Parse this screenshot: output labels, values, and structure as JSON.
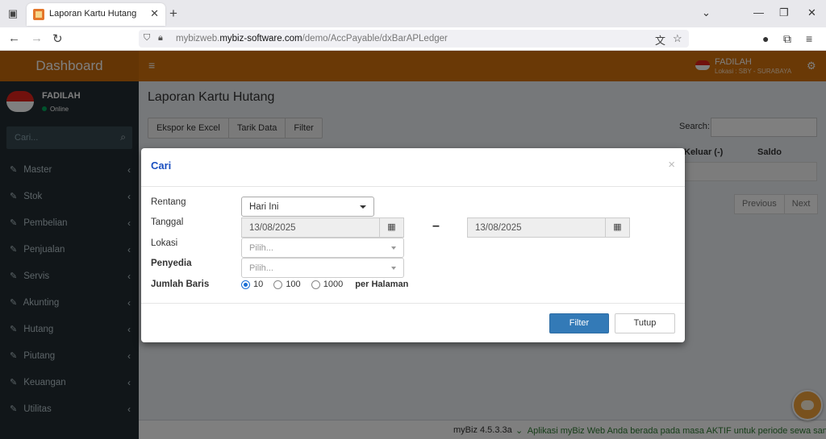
{
  "browser": {
    "tab_title": "Laporan Kartu Hutang",
    "url_prefix": "mybizweb.",
    "url_domain": "mybiz-software.com",
    "url_path": "/demo/AccPayable/dxBarAPLedger"
  },
  "header": {
    "brand": "Dashboard",
    "user_name": "FADILAH",
    "user_location": "Lokasi : SBY - SURABAYA"
  },
  "sidebar": {
    "user_name": "FADILAH",
    "status": "Online",
    "search_placeholder": "Cari...",
    "items": [
      {
        "label": "Master"
      },
      {
        "label": "Stok"
      },
      {
        "label": "Pembelian"
      },
      {
        "label": "Penjualan"
      },
      {
        "label": "Servis"
      },
      {
        "label": "Akunting"
      },
      {
        "label": "Hutang"
      },
      {
        "label": "Piutang"
      },
      {
        "label": "Keuangan"
      },
      {
        "label": "Utilitas"
      }
    ]
  },
  "page": {
    "title": "Laporan Kartu Hutang",
    "toolbar": [
      "Ekspor ke Excel",
      "Tarik Data",
      "Filter"
    ],
    "search_label": "Search:",
    "columns_visible": [
      "Keluar (-)",
      "Saldo"
    ],
    "pager": [
      "Previous",
      "Next"
    ]
  },
  "modal": {
    "title": "Cari",
    "labels": {
      "rentang": "Rentang",
      "tanggal": "Tanggal",
      "lokasi": "Lokasi",
      "penyedia": "Penyedia",
      "jumlah_baris": "Jumlah Baris"
    },
    "rentang_value": "Hari Ini",
    "date_from": "13/08/2025",
    "date_to": "13/08/2025",
    "date_separator": "–",
    "lokasi_placeholder": "Pilih...",
    "penyedia_placeholder": "Pilih...",
    "rows_options": [
      "10",
      "100",
      "1000"
    ],
    "rows_selected": "10",
    "per_page_label": "per Halaman",
    "filter_button": "Filter",
    "close_button": "Tutup"
  },
  "footer": {
    "version": "myBiz 4.5.3.3a",
    "notice": "Aplikasi myBiz Web Anda berada pada masa AKTIF untuk periode sewa sam"
  },
  "colors": {
    "header": "#d4720c",
    "sidebar": "#222d32",
    "primary_button": "#337ab7",
    "modal_title": "#1a4fc0"
  }
}
